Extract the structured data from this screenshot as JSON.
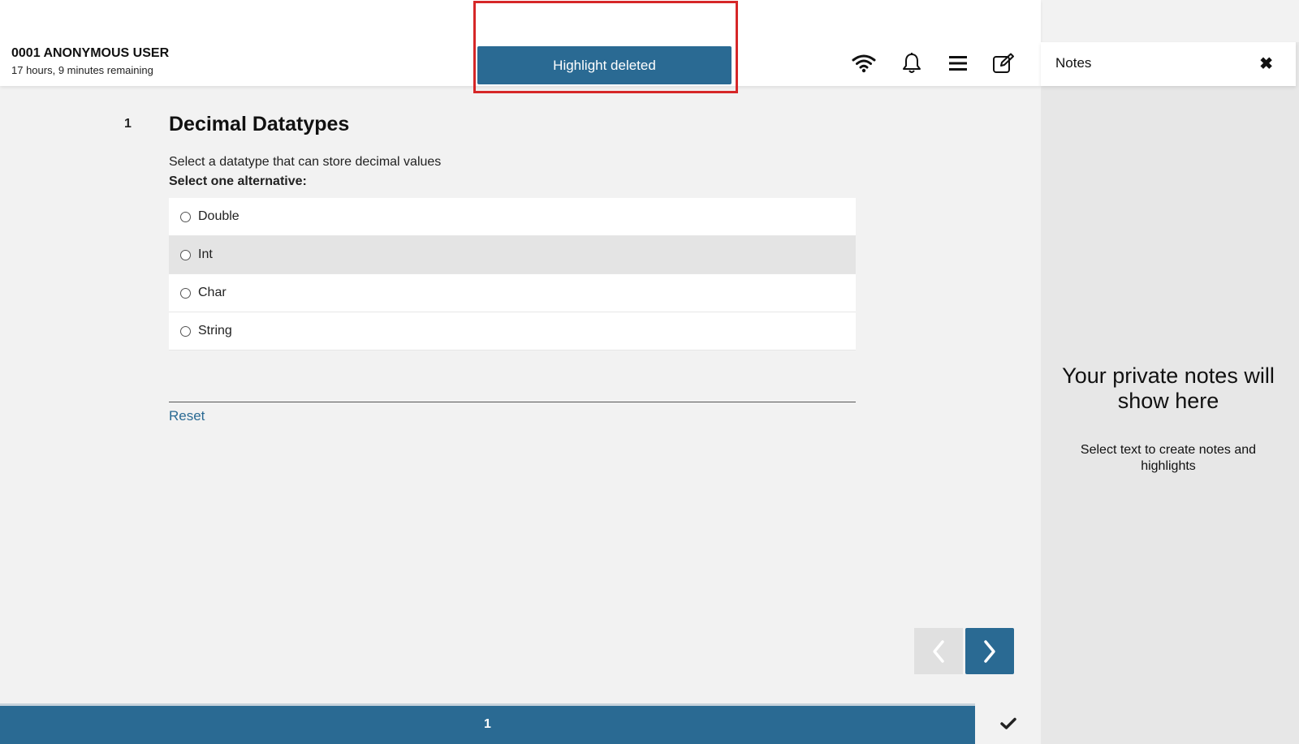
{
  "header": {
    "user_name": "0001 ANONYMOUS USER",
    "time_remaining": "17 hours, 9 minutes remaining",
    "icons": [
      "wifi-icon",
      "bell-icon",
      "menu-icon",
      "edit-note-icon"
    ]
  },
  "toast": {
    "message": "Highlight deleted"
  },
  "question": {
    "number": "1",
    "title": "Decimal Datatypes",
    "text": "Select a datatype that can store decimal values",
    "instruction": "Select one alternative:",
    "options": [
      {
        "label": "Double"
      },
      {
        "label": "Int"
      },
      {
        "label": "Char"
      },
      {
        "label": "String"
      }
    ],
    "reset_label": "Reset"
  },
  "notes": {
    "title": "Notes",
    "close_glyph": "✖",
    "empty_title": "Your private notes will show here",
    "empty_subtitle": "Select text to create notes and highlights"
  },
  "footer": {
    "page_number": "1"
  },
  "colors": {
    "primary": "#2a6a93",
    "toast_outline": "#d62728",
    "background": "#f2f2f2"
  }
}
